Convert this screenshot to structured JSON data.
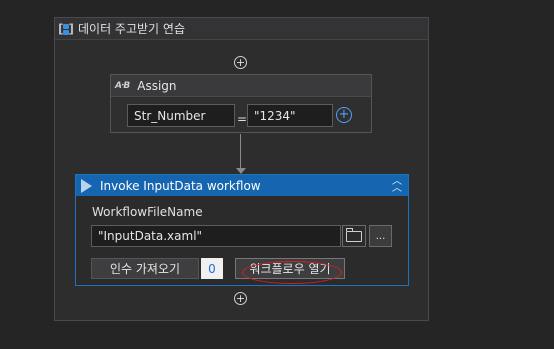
{
  "sequence": {
    "title": "데이터 주고받기 연습",
    "icon": "sequence-icon"
  },
  "assign": {
    "title": "Assign",
    "icon": "assign-ab-icon",
    "to_value": "Str_Number",
    "equals": "=",
    "value": "\"1234\""
  },
  "invoke": {
    "title": "Invoke InputData workflow",
    "file_label": "WorkflowFileName",
    "file_value": "\"InputData.xaml\"",
    "browse_label": "...",
    "import_args_label": "인수 가져오기",
    "arg_count": "0",
    "open_workflow_label": "워크플로우 열기"
  },
  "icons": {
    "ab": "A·B",
    "plus": "+"
  },
  "colors": {
    "invoke_header": "#1565b0",
    "accent": "#4ea1ff",
    "annotation": "#d32020"
  }
}
